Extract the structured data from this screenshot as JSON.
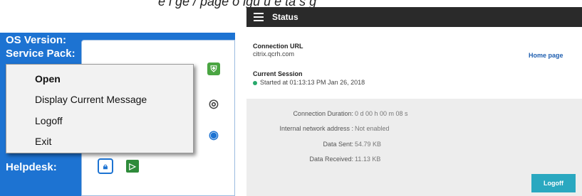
{
  "top_crop_text": "e   i ge / page   o igu   u   e ta   s     g",
  "left": {
    "labels": {
      "os_version": "OS Version:",
      "service_pack": "Service Pack:",
      "helpdesk": "Helpdesk:"
    },
    "context_menu": {
      "items": [
        "Open",
        "Display Current Message",
        "Logoff",
        "Exit"
      ]
    }
  },
  "right": {
    "header": {
      "title": "Status"
    },
    "connection_url": {
      "label": "Connection URL",
      "value": "citrix.qcrh.com"
    },
    "home_link": "Home page",
    "current_session": {
      "label": "Current Session",
      "value": "Started at 01:13:13 PM Jan 26, 2018"
    },
    "details": [
      {
        "key": "Connection Duration:",
        "value": "0 d 00 h 00 m 08 s"
      },
      {
        "key": "Internal network address :",
        "value": "Not enabled"
      },
      {
        "key": "Data Sent:",
        "value": "54.79 KB"
      },
      {
        "key": "Data Received:",
        "value": "11.13 KB"
      }
    ],
    "logoff_button": "Logoff"
  },
  "colors": {
    "windows_blue": "#1d73d2",
    "header_dark": "#2a2a2a",
    "status_green": "#27a86b",
    "button_teal": "#2aa8c0",
    "link_blue": "#1f5fb0"
  }
}
